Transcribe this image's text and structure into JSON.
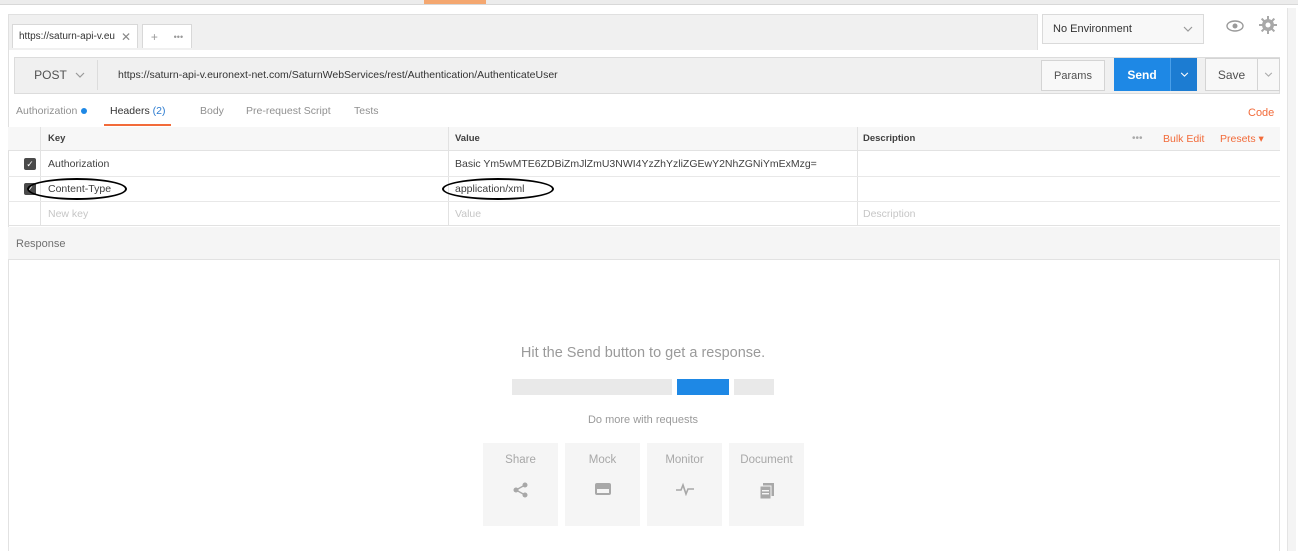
{
  "tabs": [
    {
      "label": "https://saturn-api-v.eu"
    }
  ],
  "environment": {
    "selected": "No Environment"
  },
  "request": {
    "method": "POST",
    "url": "https://saturn-api-v.euronext-net.com/SaturnWebServices/rest/Authentication/AuthenticateUser",
    "params_label": "Params",
    "send_label": "Send",
    "save_label": "Save"
  },
  "subtabs": {
    "authorization": "Authorization",
    "headers": "Headers",
    "headers_count": "(2)",
    "body": "Body",
    "prerequest": "Pre-request Script",
    "tests": "Tests",
    "code": "Code"
  },
  "headers_table": {
    "columns": {
      "key": "Key",
      "value": "Value",
      "description": "Description"
    },
    "actions": {
      "more": "•••",
      "bulk_edit": "Bulk Edit",
      "presets": "Presets ▾"
    },
    "rows": [
      {
        "checked": true,
        "key": "Authorization",
        "value": "Basic Ym5wMTE6ZDBiZmJlZmU3NWI4YzZhYzliZGEwY2NhZGNiYmExMzg="
      },
      {
        "checked": true,
        "key": "Content-Type",
        "value": "application/xml"
      }
    ],
    "new_row": {
      "key_placeholder": "New key",
      "value_placeholder": "Value",
      "description_placeholder": "Description"
    }
  },
  "response": {
    "label": "Response",
    "hint": "Hit the Send button to get a response.",
    "more_label": "Do more with requests",
    "cards": [
      {
        "label": "Share",
        "icon": "share-icon"
      },
      {
        "label": "Mock",
        "icon": "mock-icon"
      },
      {
        "label": "Monitor",
        "icon": "monitor-icon"
      },
      {
        "label": "Document",
        "icon": "document-icon"
      }
    ]
  },
  "colors": {
    "accent_orange": "#f26b3a",
    "send_blue": "#1e88e5"
  }
}
